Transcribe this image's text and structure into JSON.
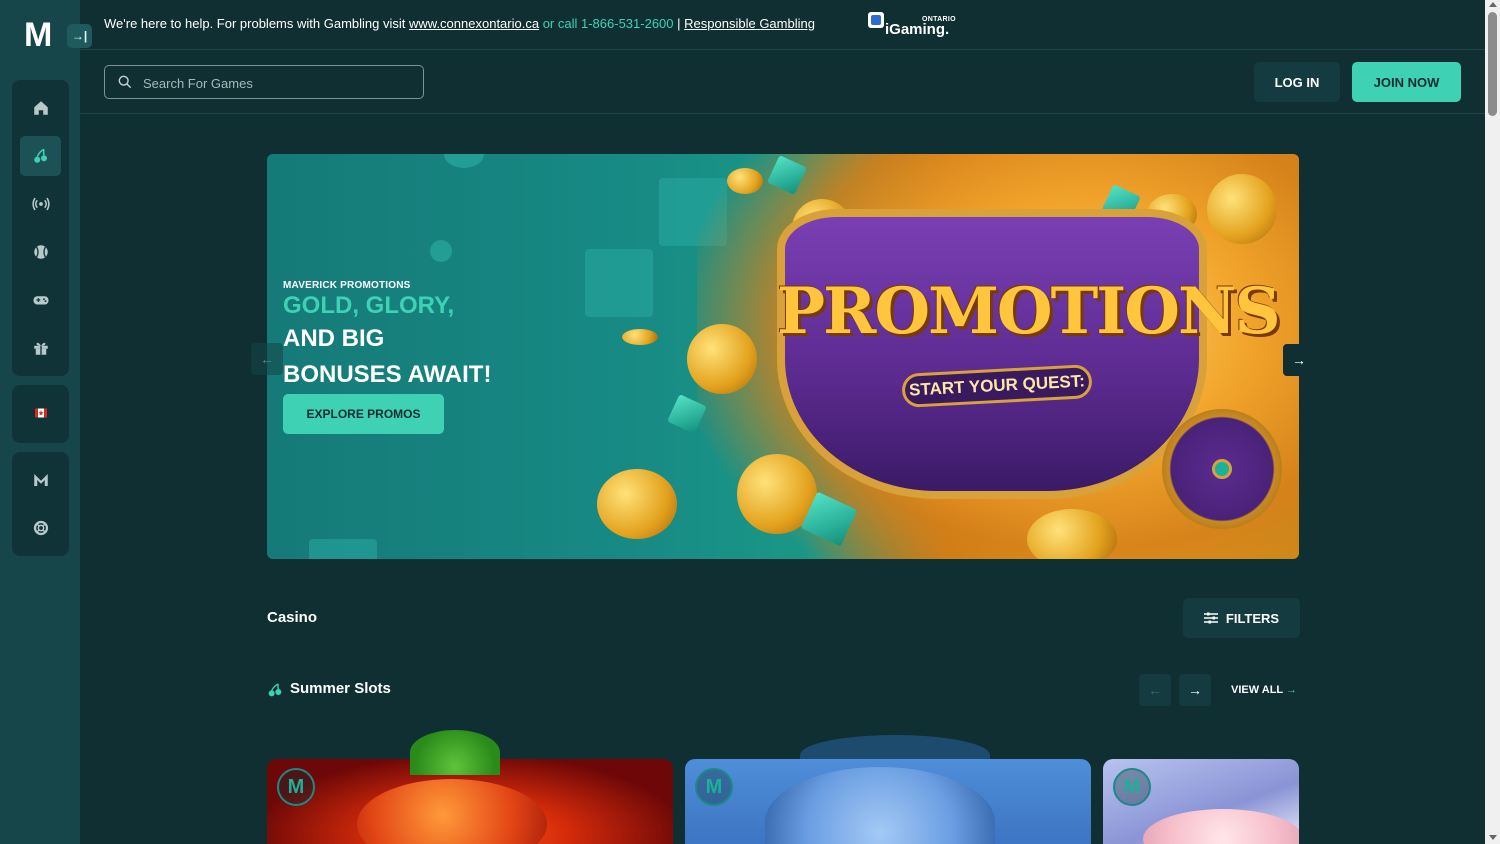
{
  "brand": {
    "logo": "M",
    "accent": "#3fd1b3"
  },
  "notice": {
    "text": "We're here to help. For problems with Gambling visit",
    "link": "www.connexontario.ca",
    "call": "or call 1-866-531-2600",
    "separator": "|",
    "responsible": "Responsible Gambling",
    "regulator_top": "ONTARIO",
    "regulator_main": "iGaming."
  },
  "collapse_icon": "→|",
  "search": {
    "placeholder": "Search For Games"
  },
  "auth": {
    "login": "LOG IN",
    "join": "JOIN NOW"
  },
  "sidebar": {
    "items": [
      {
        "icon": "home-icon"
      },
      {
        "icon": "cherries-icon",
        "active": true
      },
      {
        "icon": "live-broadcast-icon"
      },
      {
        "icon": "sports-ball-icon"
      },
      {
        "icon": "gamepad-icon"
      },
      {
        "icon": "gift-icon"
      },
      {
        "icon": "canada-flag-icon"
      },
      {
        "icon": "maverick-logo-icon"
      },
      {
        "icon": "support-lifebuoy-icon"
      }
    ]
  },
  "hero": {
    "kicker": "MAVERICK PROMOTIONS",
    "line1": "GOLD, GLORY,",
    "line2": "AND BIG",
    "line3": "BONUSES AWAIT!",
    "cta": "EXPLORE PROMOS",
    "art_title": "PROMOTIONS",
    "art_subtitle": "START YOUR QUEST:",
    "prev": "←",
    "next": "→"
  },
  "casino": {
    "title": "Casino",
    "filters": "FILTERS"
  },
  "section": {
    "title": "Summer Slots",
    "view_all": "VIEW ALL",
    "view_all_arrow": "→",
    "prev": "←",
    "next": "→"
  },
  "cards": [
    {
      "badge": "M"
    },
    {
      "badge": "M"
    },
    {
      "badge": "M"
    }
  ]
}
